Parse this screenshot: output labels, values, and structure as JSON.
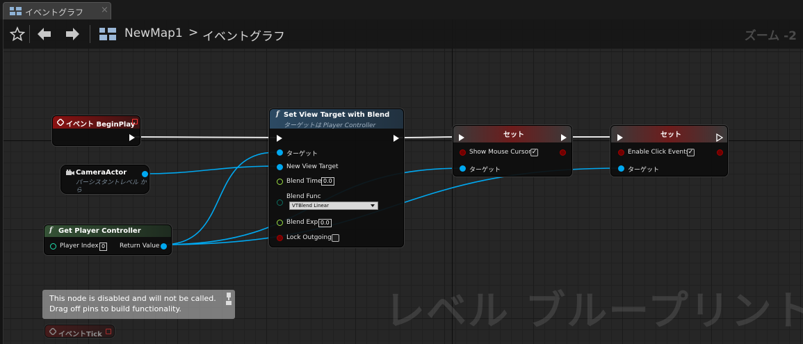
{
  "tab": {
    "label": "イベントグラフ",
    "close": "×"
  },
  "toolbar": {
    "breadcrumb_map": "NewMap1",
    "breadcrumb_separator": ">",
    "breadcrumb_graph": "イベントグラフ",
    "zoom": "ズーム -2"
  },
  "icons": {
    "favorite": "star-icon",
    "back": "arrow-left-icon",
    "forward": "arrow-right-icon",
    "graph": "event-graph-icon"
  },
  "colors": {
    "event_header": "#8a1212",
    "function_header": "#2c4a63",
    "pure_header": "#355236",
    "set_header": "#6e1c1c",
    "object_pin": "#00a8f0",
    "float_pin": "#9de043"
  },
  "nodes": {
    "begin_play": {
      "title": "イベント BeginPlay"
    },
    "camera_actor": {
      "title": "CameraActor",
      "subtitle_1": "パーシスタントレベル か",
      "subtitle_2": "ら"
    },
    "get_player_controller": {
      "title": "Get Player Controller",
      "player_index_label": "Player Index",
      "player_index_value": "0",
      "return_value_label": "Return Value"
    },
    "set_view_target": {
      "title": "Set View Target with Blend",
      "subtitle": "ターゲットは Player Controller",
      "target_label": "ターゲット",
      "new_view_target_label": "New View Target",
      "blend_time_label": "Blend Time",
      "blend_time_value": "0.0",
      "blend_func_label": "Blend Func",
      "blend_func_value": "VTBlend Linear",
      "blend_exp_label": "Blend Exp",
      "blend_exp_value": "0.0",
      "lock_outgoing_label": "Lock Outgoing"
    },
    "set_mouse": {
      "title": "セット",
      "show_mouse_cursor_label": "Show Mouse Cursor",
      "target_label": "ターゲット",
      "checked": "✓"
    },
    "set_click": {
      "title": "セット",
      "enable_click_events_label": "Enable Click Events",
      "target_label": "ターゲット",
      "checked": "✓"
    },
    "event_tick": {
      "title": "イベントTick"
    }
  },
  "comment": {
    "line1": "This node is disabled and will not be called.",
    "line2": "Drag off pins to build functionality."
  },
  "watermark": "レベル ブループリント"
}
